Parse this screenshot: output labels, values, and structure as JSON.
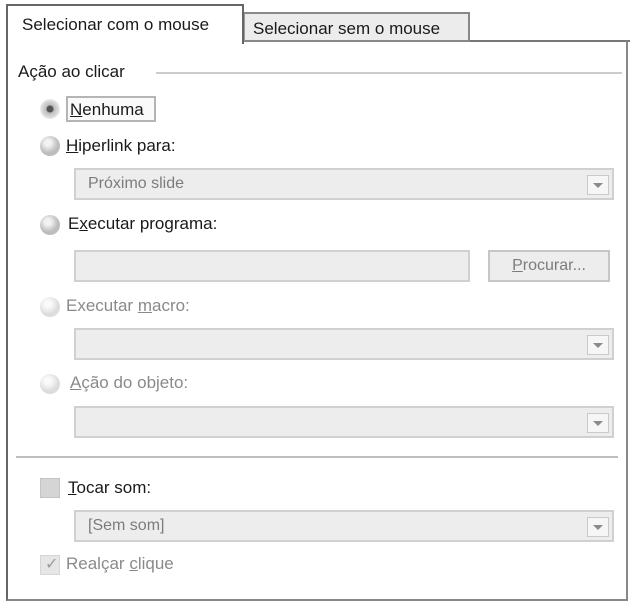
{
  "tabs": [
    {
      "label": "Selecionar com o mouse",
      "active": true
    },
    {
      "label": "Selecionar sem o mouse",
      "active": false
    }
  ],
  "group": {
    "label": "Ação ao clicar"
  },
  "options": {
    "none": {
      "mnemonic": "N",
      "rest": "enhuma",
      "selected": true
    },
    "hyperlink": {
      "mnemonic": "H",
      "rest": "iperlink para:",
      "value": "Próximo slide"
    },
    "run_program": {
      "pre": "E",
      "mnemonic": "x",
      "rest": "ecutar programa:",
      "value": "",
      "browse_mnemonic": "P",
      "browse_rest": "rocurar..."
    },
    "run_macro": {
      "pre": "Executar ",
      "mnemonic": "m",
      "rest": "acro:",
      "value": ""
    },
    "object_action": {
      "mnemonic": "A",
      "rest": "ção do objeto:",
      "value": ""
    }
  },
  "sound": {
    "mnemonic": "T",
    "rest": "ocar som:",
    "checked": false,
    "value": "[Sem som]"
  },
  "highlight": {
    "pre": "Realçar ",
    "mnemonic": "c",
    "rest": "lique",
    "checked": true
  },
  "colors": {
    "border": "#666666",
    "disabled_text": "#8a8a8a",
    "field_bg": "#ededed"
  }
}
